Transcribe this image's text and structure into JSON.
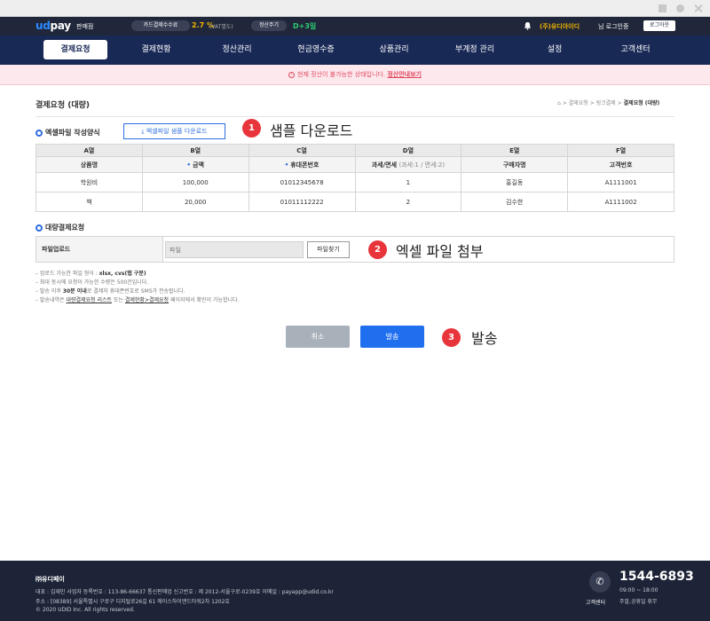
{
  "header": {
    "logo_ud": "ud",
    "logo_pay": "pay",
    "logo_sub": "판매점",
    "fee_label": "카드결제수수료",
    "fee_value": "2.7 %",
    "fee_note": "(VAT별도)",
    "cycle_label": "정산주기",
    "cycle_value": "D+3일",
    "user_name": "(주)유디아이디",
    "user_suffix": "님 로그인중",
    "logout": "로그아웃"
  },
  "nav": {
    "items": [
      {
        "label": "결제요청"
      },
      {
        "label": "결제현황"
      },
      {
        "label": "정산관리"
      },
      {
        "label": "현금영수증"
      },
      {
        "label": "상품관리"
      },
      {
        "label": "부계정 관리"
      },
      {
        "label": "설정"
      },
      {
        "label": "고객센터"
      }
    ]
  },
  "notice": {
    "text": "현재 정산이 불가능한 상태입니다.",
    "link": "정산안내보기"
  },
  "page": {
    "title": "결제요청 (대량)",
    "breadcrumb": {
      "b1": "결제요청",
      "b2": "링크결제",
      "current": "결제요청 (대량)"
    }
  },
  "excel_section": {
    "title": "엑셀파일 작성양식",
    "sample_button": "엑셀파일 샘플 다운로드"
  },
  "steps": [
    {
      "num": "1",
      "label": "샘플 다운로드"
    },
    {
      "num": "2",
      "label": "엑셀 파일 첨부"
    },
    {
      "num": "3",
      "label": "발송"
    }
  ],
  "table": {
    "columns": [
      "A열",
      "B열",
      "C열",
      "D열",
      "E열",
      "F열"
    ],
    "fields": {
      "a": "상품명",
      "b": "금액",
      "c": "휴대폰번호",
      "d": "과세/면세",
      "d_note": "(과세:1 / 면세:2)",
      "e": "구매자명",
      "f": "고객번호"
    },
    "rows": [
      [
        "학원비",
        "100,000",
        "01012345678",
        "1",
        "홍길동",
        "A1111001"
      ],
      [
        "책",
        "20,000",
        "01011112222",
        "2",
        "김수한",
        "A1111002"
      ]
    ]
  },
  "bulk_section": {
    "title": "대량결제요청",
    "upload_label": "파일업로드",
    "file_placeholder": "파일",
    "find_button": "파일찾기"
  },
  "guide": {
    "l1_a": "– 업로드 가능한 파일 형식 : ",
    "l1_b": "xlsx, cvs(탭 구분)",
    "l2": "– 최대 동시에 요청이 가능한 수량은 500건입니다.",
    "l3_a": "– 발송 이후 ",
    "l3_b": "30분 이내",
    "l3_c": "로 결제자 휴대폰번호로 SMS가 전송됩니다.",
    "l4_a": "– 발송내역은 ",
    "l4_b": "대량결제요청 리스트",
    "l4_c": " 또는 ",
    "l4_d": "결제현황>결제요청",
    "l4_e": " 페이지에서 확인이 가능합니다."
  },
  "actions": {
    "cancel": "취소",
    "send": "발송"
  },
  "footer": {
    "company": "㈜유디페이",
    "line1": "대표 : 김재민 사업자 등록번호 : 113-86-66637 통신판매업 신고번호 : 제 2012-서울구로-0239호 이메일 : payapp@udid.co.kr",
    "line2": "주소 : [08389] 서울특별시 구로구 디지털로26길 61 에이스하이엔드타워2차 1202호",
    "line3": "© 2020 UDID Inc. All rights reserved.",
    "cs_label": "고객센터",
    "tel": "1544-6893",
    "hours": "09:00 ~ 18:00",
    "off": "주말,공휴일 휴무"
  }
}
